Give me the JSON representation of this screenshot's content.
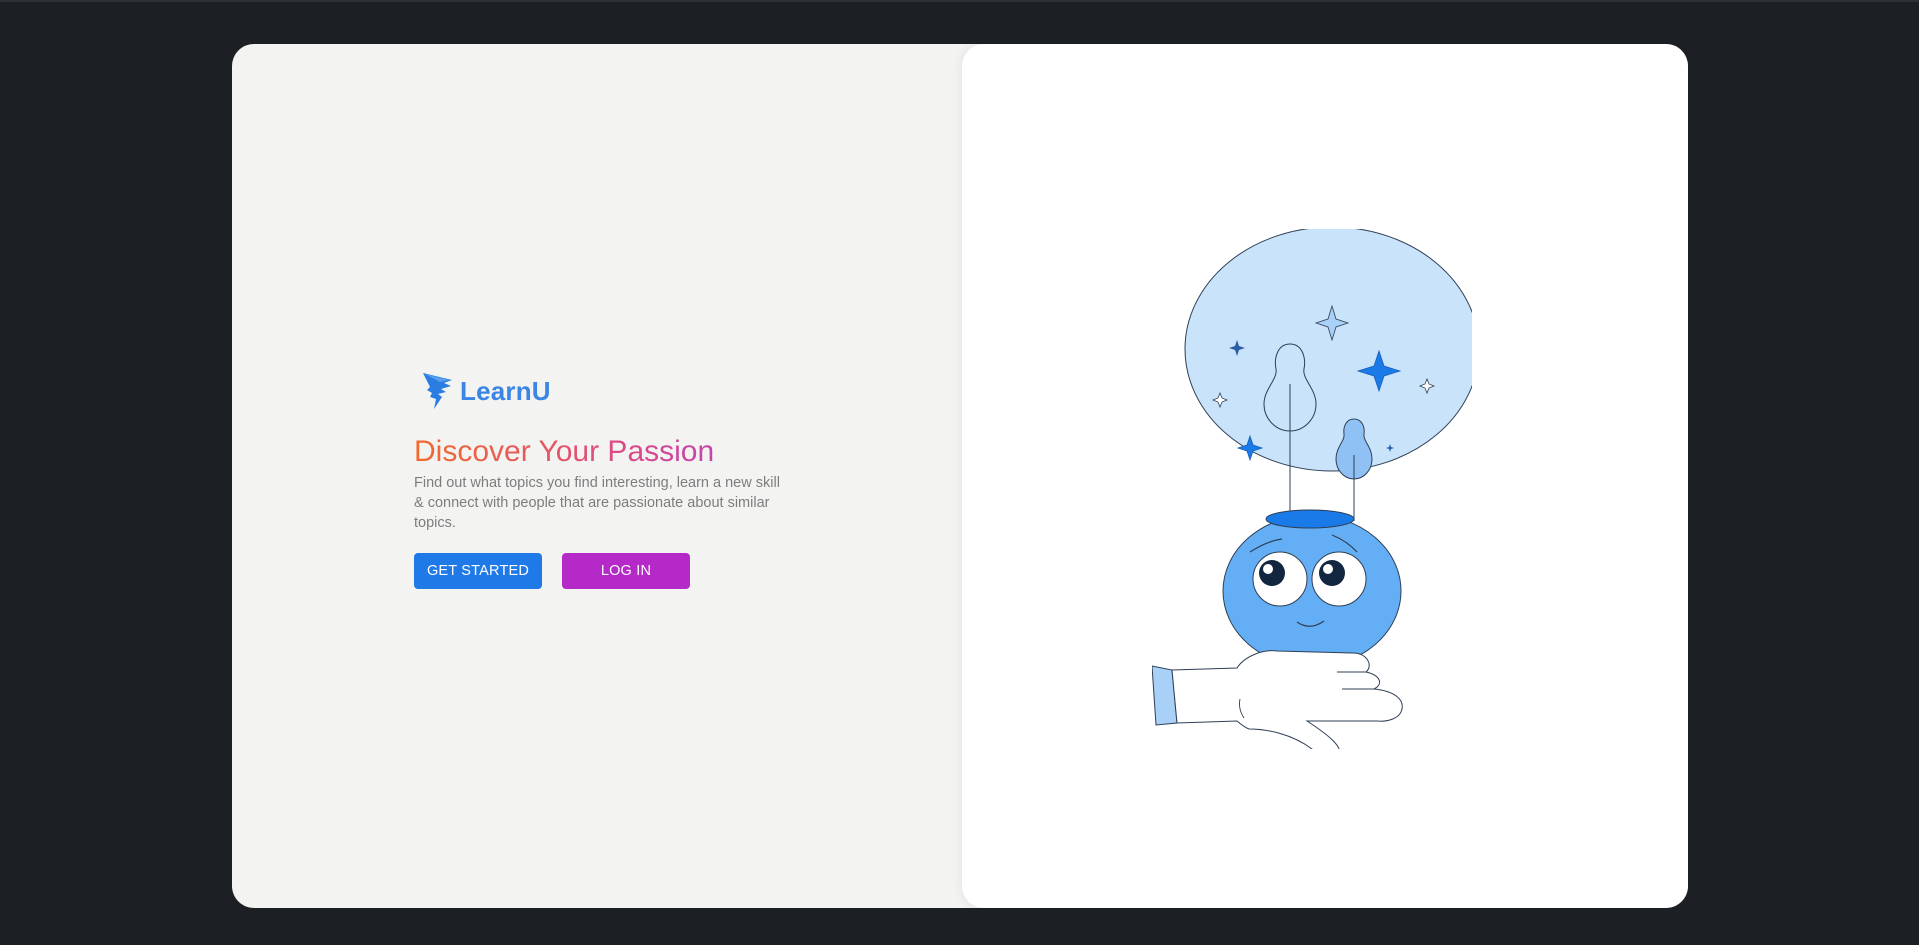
{
  "brand": {
    "name": "LearnU",
    "logo_icon": "winged-bolt-icon",
    "color": "#3b86e4"
  },
  "hero": {
    "headline": "Discover Your Passion",
    "description": "Find out what topics you find interesting, learn a new skill & connect with people that are passionate about similar topics."
  },
  "actions": {
    "get_started_label": "GET STARTED",
    "log_in_label": "LOG IN",
    "primary_color": "#1f7ae8",
    "secondary_color": "#b529c8"
  },
  "illustration": {
    "icon": "idea-head-on-hand-illustration"
  }
}
